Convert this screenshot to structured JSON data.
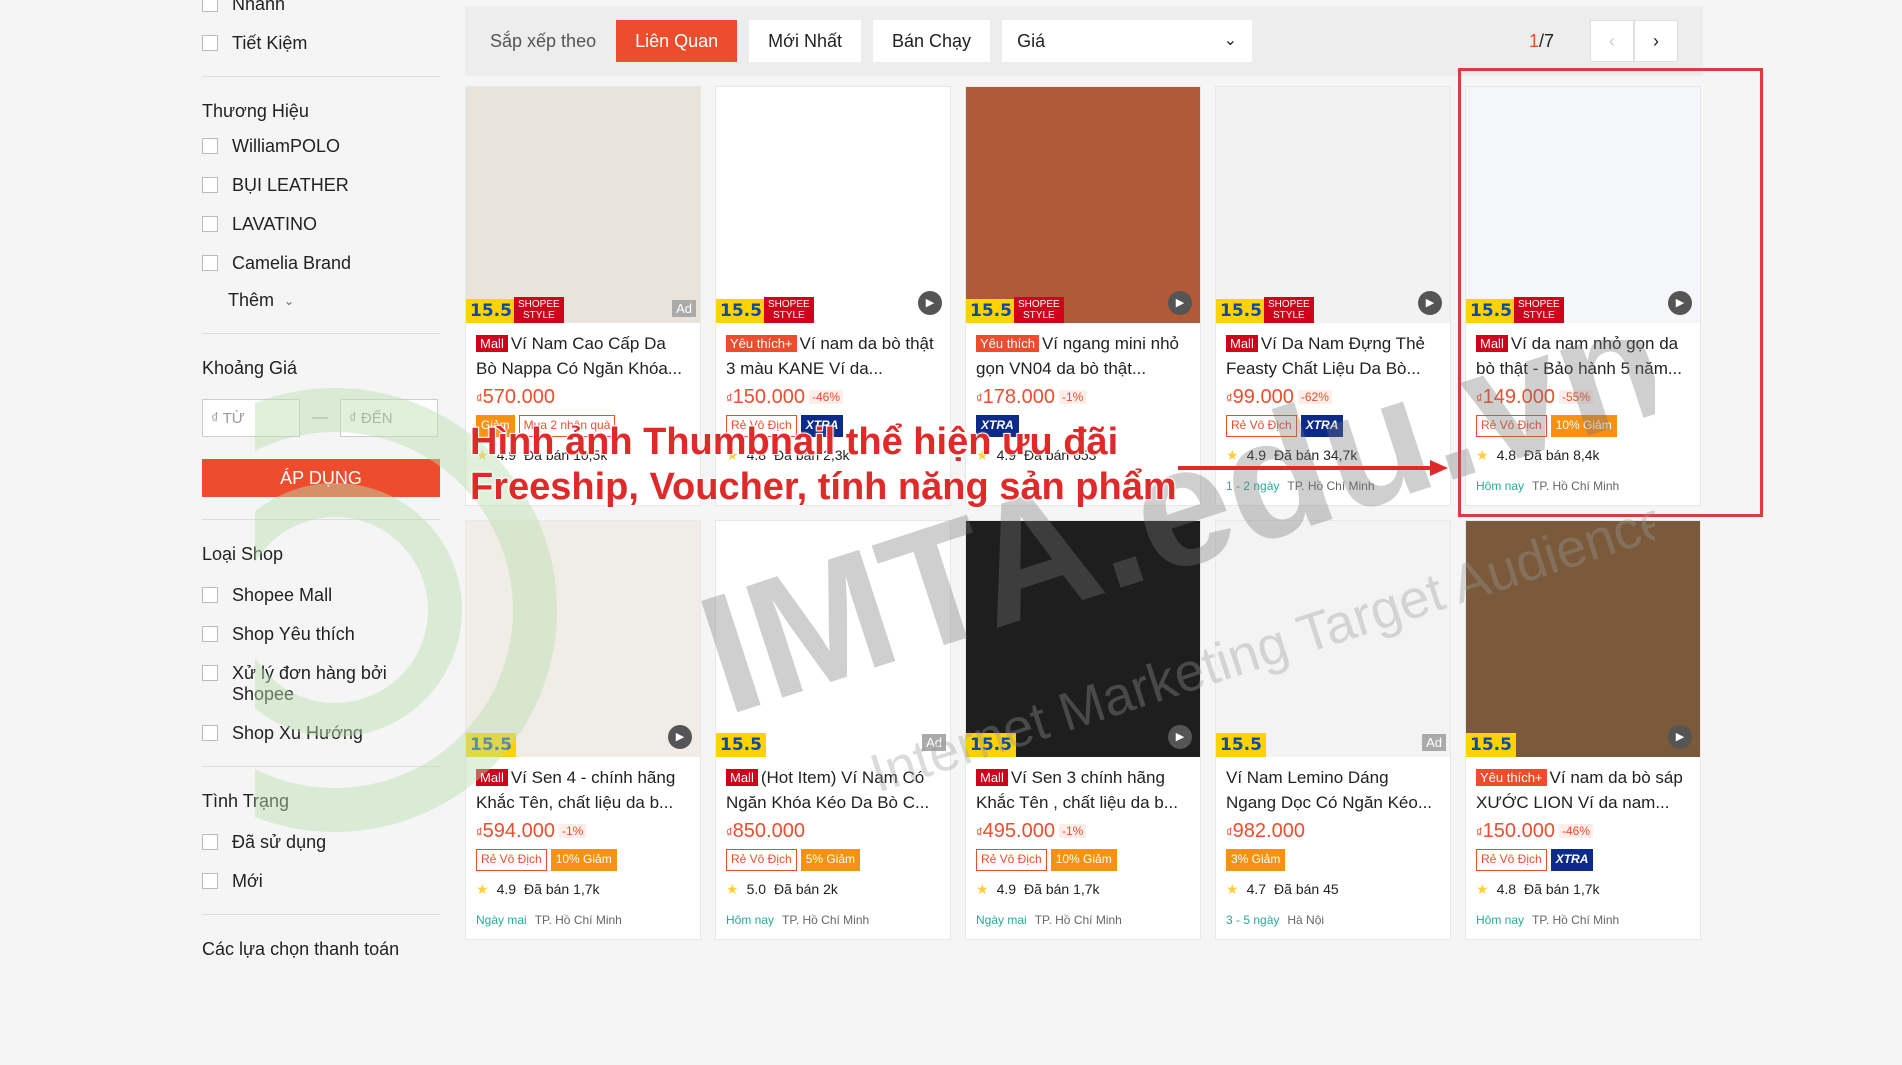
{
  "sidebar": {
    "top_options": [
      "Nhanh",
      "Tiết Kiệm"
    ],
    "brand_title": "Thương Hiệu",
    "brands": [
      "WilliamPOLO",
      "BỤI LEATHER",
      "LAVATINO",
      "Camelia Brand"
    ],
    "more_label": "Thêm",
    "price_title": "Khoảng Giá",
    "price_from_placeholder": "₫ TỪ",
    "price_to_placeholder": "₫ ĐẾN",
    "apply_label": "ÁP DỤNG",
    "shop_type_title": "Loại Shop",
    "shop_types": [
      "Shopee Mall",
      "Shop Yêu thích",
      "Xử lý đơn hàng bởi Shopee",
      "Shop Xu Hướng"
    ],
    "condition_title": "Tình Trạng",
    "conditions": [
      "Đã sử dụng",
      "Mới"
    ],
    "payment_title": "Các lựa chọn thanh toán"
  },
  "sortbar": {
    "label": "Sắp xếp theo",
    "relevant": "Liên Quan",
    "newest": "Mới Nhất",
    "best_selling": "Bán Chạy",
    "price": "Giá",
    "page_current": "1",
    "page_total": "/7"
  },
  "products": [
    {
      "tag": "Mall",
      "name": "Ví Nam Cao Cấp Da Bò Nappa Có Ngăn Khóa...",
      "price": "570.000",
      "discount": "",
      "labels": [
        "Giảm",
        "Mua 2 nhận quà"
      ],
      "rating": "4.9",
      "sold": "Đã bán 10,5k",
      "ship": "",
      "loc": "",
      "ad": "Ad",
      "img": "#e8e4dc"
    },
    {
      "tag": "Yêu thích+",
      "name": "Ví nam da bò thật 3 màu KANE Ví da...",
      "price": "150.000",
      "discount": "-46%",
      "labels": [
        "Rẻ Vô Địch",
        "XTRA"
      ],
      "rating": "4.8",
      "sold": "Đã bán 2,3k",
      "ship": "",
      "loc": "",
      "ad": "",
      "img": "#ffffff"
    },
    {
      "tag": "Yêu thích",
      "name": "Ví ngang mini nhỏ gọn VN04 da bò thật...",
      "price": "178.000",
      "discount": "-1%",
      "labels": [
        "XTRA"
      ],
      "rating": "4.9",
      "sold": "Đã bán 653",
      "ship": "",
      "loc": "",
      "ad": "",
      "img": "#b05a3a"
    },
    {
      "tag": "Mall",
      "name": "Ví Da Nam Đựng Thẻ Feasty Chất Liệu Da Bò...",
      "price": "99.000",
      "discount": "-62%",
      "labels": [
        "Rẻ Vô Địch",
        "XTRA"
      ],
      "rating": "4.9",
      "sold": "Đã bán 34,7k",
      "ship": "1 - 2 ngày",
      "loc": "TP. Hồ Chí Minh",
      "ad": "",
      "img": "#f2f2f2"
    },
    {
      "tag": "Mall",
      "name": "Ví da nam nhỏ gọn da bò thật - Bảo hành 5 năm...",
      "price": "149.000",
      "discount": "-55%",
      "labels": [
        "Rẻ Vô Địch",
        "10% Giảm"
      ],
      "rating": "4.8",
      "sold": "Đã bán 8,4k",
      "ship": "Hôm nay",
      "loc": "TP. Hồ Chí Minh",
      "ad": "",
      "img": "#f4f6fa"
    },
    {
      "tag": "",
      "name": "",
      "price": "",
      "discount": "",
      "labels": [],
      "rating": "",
      "sold": "",
      "ship": "",
      "loc": "",
      "ad": "",
      "img": "#f5f5f5"
    },
    {
      "tag": "Mall",
      "name": "Ví Sen 4 - chính hãng Khắc Tên, chất liệu da b...",
      "price": "594.000",
      "discount": "-1%",
      "labels": [
        "Rẻ Vô Địch",
        "10% Giảm"
      ],
      "rating": "4.9",
      "sold": "Đã bán 1,7k",
      "ship": "Ngày mai",
      "loc": "TP. Hồ Chí Minh",
      "ad": "",
      "img": "#f0ece6"
    },
    {
      "tag": "Mall",
      "name": "(Hot Item) Ví Nam Có Ngăn Khóa Kéo Da Bò C...",
      "price": "850.000",
      "discount": "",
      "labels": [
        "Rẻ Vô Địch",
        "5% Giảm"
      ],
      "rating": "5.0",
      "sold": "Đã bán 2k",
      "ship": "Hôm nay",
      "loc": "TP. Hồ Chí Minh",
      "ad": "Ad",
      "img": "#ffffff"
    },
    {
      "tag": "Mall",
      "name": "Ví Sen 3 chính hãng Khắc Tên , chất liệu da b...",
      "price": "495.000",
      "discount": "-1%",
      "labels": [
        "Rẻ Vô Địch",
        "10% Giảm"
      ],
      "rating": "4.9",
      "sold": "Đã bán 1,7k",
      "ship": "Ngày mai",
      "loc": "TP. Hồ Chí Minh",
      "ad": "",
      "img": "#1e1e1e"
    },
    {
      "tag": "",
      "name": "Ví Nam Lemino Dáng Ngang Dọc Có Ngăn Kéo...",
      "price": "982.000",
      "discount": "",
      "labels": [
        "3% Giảm"
      ],
      "rating": "4.7",
      "sold": "Đã bán 45",
      "ship": "3 - 5 ngày",
      "loc": "Hà Nội",
      "ad": "Ad",
      "img": "#f3f3f3"
    },
    {
      "tag": "Yêu thích+",
      "name": "Ví nam da bò sáp XƯỚC LION Ví da nam...",
      "price": "150.000",
      "discount": "-46%",
      "labels": [
        "Rẻ Vô Địch",
        "XTRA"
      ],
      "rating": "4.8",
      "sold": "Đã bán 1,7k",
      "ship": "Hôm nay",
      "loc": "TP. Hồ Chí Minh",
      "ad": "",
      "img": "#7a5a3a"
    },
    {
      "tag": "",
      "name": "",
      "price": "",
      "discount": "",
      "labels": [],
      "rating": "",
      "sold": "",
      "ship": "",
      "loc": "",
      "ad": "",
      "img": "#f5f5f5"
    }
  ],
  "annotation": {
    "line1": "Hình ảnh Thumbnail thể hiện ưu đãi",
    "line2": "Freeship, Voucher, tính năng sản phẩm"
  },
  "watermark": {
    "brand": "IMTA.edu.vn",
    "tagline": "Internet Marketing Target Audience"
  },
  "colors": {
    "accent": "#ee4d2d",
    "highlight": "#e03a3a"
  }
}
